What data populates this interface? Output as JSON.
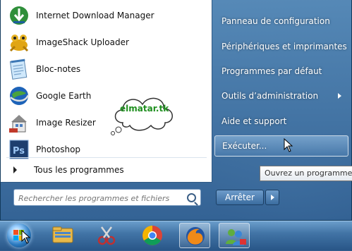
{
  "start_menu": {
    "programs": [
      {
        "label": "Internet Download Manager",
        "icon": "idm-icon"
      },
      {
        "label": "ImageShack Uploader",
        "icon": "frog-icon"
      },
      {
        "label": "Bloc-notes",
        "icon": "notepad-icon"
      },
      {
        "label": "Google Earth",
        "icon": "google-earth-icon"
      },
      {
        "label": "Image Resizer",
        "icon": "image-resizer-icon"
      },
      {
        "label": "Photoshop",
        "icon": "photoshop-icon"
      }
    ],
    "all_programs_label": "Tous les programmes",
    "search_placeholder": "Rechercher les programmes et fichiers",
    "right_items": [
      {
        "label": "Panneau de configuration",
        "has_submenu": false
      },
      {
        "label": "Périphériques et imprimantes",
        "has_submenu": false
      },
      {
        "label": "Programmes par défaut",
        "has_submenu": false
      },
      {
        "label": "Outils d’administration",
        "has_submenu": true
      },
      {
        "label": "Aide et support",
        "has_submenu": false
      },
      {
        "label": "Exécuter...",
        "has_submenu": false,
        "highlighted": true
      }
    ],
    "shutdown_label": "Arrêter",
    "tooltip": "Ouvrez un programme, "
  },
  "watermark": {
    "text": "elmatar.tk"
  },
  "photoshop_abbr": "Ps",
  "taskbar": {
    "items": [
      {
        "name": "explorer-icon"
      },
      {
        "name": "snipping-tool-icon"
      },
      {
        "name": "chrome-icon"
      },
      {
        "name": "firefox-icon",
        "active": true
      },
      {
        "name": "network-users-icon"
      }
    ]
  },
  "colors": {
    "menu_text": "#ffffff",
    "watermark_green": "#1f8f1f"
  }
}
